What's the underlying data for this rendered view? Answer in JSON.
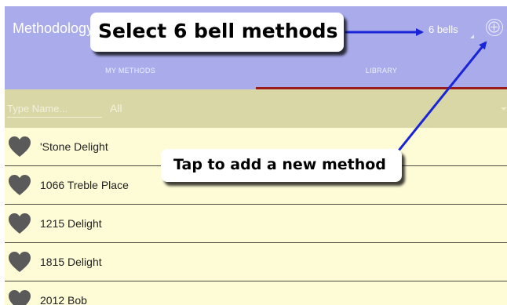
{
  "app": {
    "title": "Methodology",
    "bells_label": "6 bells",
    "add_icon": "add-circle-icon"
  },
  "tabs": [
    {
      "label": "MY METHODS",
      "selected": false
    },
    {
      "label": "LIBRARY",
      "selected": true
    }
  ],
  "filter": {
    "search_placeholder": "Type Name...",
    "selected_value": "All"
  },
  "methods": [
    {
      "name": "'Stone Delight",
      "icon": "heart-icon"
    },
    {
      "name": "1066 Treble Place",
      "icon": "heart-icon"
    },
    {
      "name": "1215 Delight",
      "icon": "heart-icon"
    },
    {
      "name": "1815 Delight",
      "icon": "heart-icon"
    },
    {
      "name": "2012 Bob",
      "icon": "heart-icon"
    }
  ],
  "annotations": {
    "select_bells": "Select 6 bell methods",
    "add_method": "Tap to add a new method"
  },
  "colors": {
    "action_bar": "#a9abeb",
    "tab_indicator": "#9b1b1b",
    "filter_bar": "#d9d7a6",
    "list_background": "#fefcd6",
    "heart": "#5a5a5a",
    "arrow": "#1a25d8"
  }
}
